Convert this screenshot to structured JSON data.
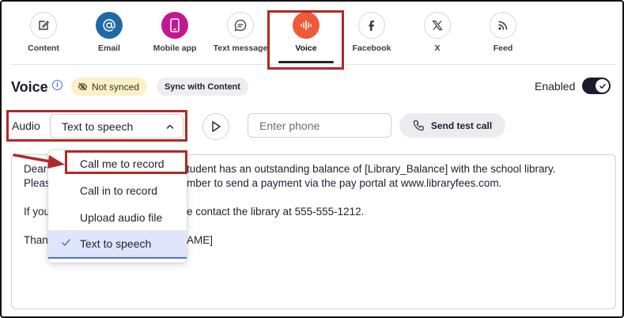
{
  "channels": [
    {
      "label": "Content",
      "icon": "edit-icon"
    },
    {
      "label": "Email",
      "icon": "at-sign-icon"
    },
    {
      "label": "Mobile app",
      "icon": "mobile-icon"
    },
    {
      "label": "Text message",
      "icon": "chat-bubble-icon"
    },
    {
      "label": "Voice",
      "icon": "audio-wave-icon"
    },
    {
      "label": "Facebook",
      "icon": "facebook-icon"
    },
    {
      "label": "X",
      "icon": "x-icon"
    },
    {
      "label": "Feed",
      "icon": "rss-icon"
    }
  ],
  "voice": {
    "title": "Voice",
    "status_badge": "Not synced",
    "sync_button": "Sync with Content",
    "enabled_label": "Enabled",
    "enabled": true
  },
  "audio": {
    "label": "Audio",
    "selected": "Text to speech",
    "options": [
      "Call me to record",
      "Call in to record",
      "Upload audio file",
      "Text to speech"
    ]
  },
  "phone": {
    "placeholder": "Enter phone"
  },
  "send_test_call": "Send test call",
  "message_lines": [
    "Dear",
    "Pleas",
    "If you",
    "Than"
  ],
  "message_lines_right": [
    "tudent has an outstanding balance of [Library_Balance] with the school library.",
    "mber to send a payment via the pay portal at www.libraryfees.com.",
    "e contact the library at 555-555-1212.",
    "AME]"
  ],
  "colors": {
    "email": "#1f6aa5",
    "mobile": "#c2188f",
    "voice": "#ee5a36",
    "highlight": "#b02a2a",
    "selected_option": "#dfe6fb"
  }
}
